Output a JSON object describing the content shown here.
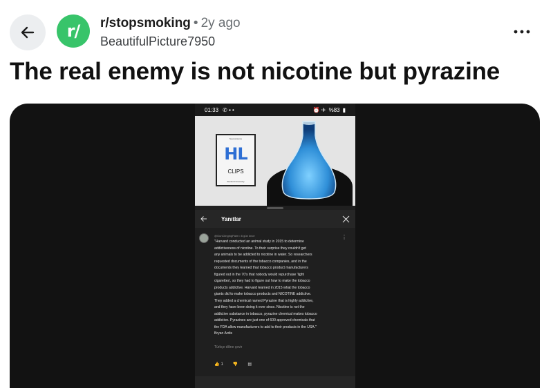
{
  "header": {
    "subreddit": "r/stopsmoking",
    "separator": "•",
    "age": "2y ago",
    "username": "BeautifulPicture7950",
    "avatar_text": "r/"
  },
  "post": {
    "title": "The real enemy is not nicotine but pyrazine"
  },
  "screenshot": {
    "status_time": "01:33",
    "status_battery": "%83",
    "book": {
      "top": "Neuroscience",
      "logo": "HL",
      "clips": "CLIPS",
      "bottom": "Stanford University"
    },
    "replies_title": "Yanıtlar",
    "comment_meta": "@GunClingingPalm • 6 gün önce",
    "comment_lines": [
      "\"Harvard conducted an animal study in 2015 to determine",
      "addictiveness of nicotine. To their surprise they couldn't get",
      "any animals to be addicted to nicotine in water. So researchers",
      "requested documents of the tobacco companies, and in the",
      "documents they learned that tobacco product manufacturers",
      "figured out in the 70's that nobody would repurchase 'light",
      "cigarettes', so they had to figure out how to make the tobacco",
      "products addictive. Harvard learned in 2015 what the tobacco",
      "giants did to make tobacco products and NICOTINE addictive.",
      " They added a chemical named Pyrazine that is highly addictive,",
      "and they have been doing it ever since. Nicotine is not the",
      "addictive substance in tobacco, pyrazine chemical makes tobacco",
      "addictive. Pyrazines are just one of  600 approved chemicals that",
      "the FDA allow manufacturers to add to their products in the USA.\"",
      "Bryan Ardis"
    ],
    "translate": "Türkçe diline çevir",
    "like_count": "1"
  },
  "colors": {
    "subreddit_avatar": "#38c46a",
    "media_background": "#121212",
    "flask_blue": "#2f8fd8"
  }
}
